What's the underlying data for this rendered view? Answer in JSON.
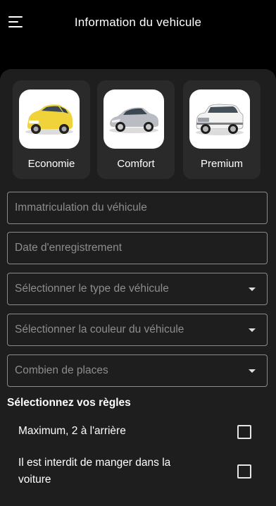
{
  "header": {
    "title": "Information du vehicule",
    "menu_icon": "hamburger-menu-icon"
  },
  "categories": [
    {
      "label": "Economie",
      "image": "yellow-hatchback-car"
    },
    {
      "label": "Comfort",
      "image": "silver-sedan-car"
    },
    {
      "label": "Premium",
      "image": "white-suv-car"
    }
  ],
  "form": {
    "registration_placeholder": "Immatriculation du véhicule",
    "date_placeholder": "Date d'enregistrement",
    "type_placeholder": "Sélectionner le type de véhicule",
    "color_placeholder": "Sélectionner la couleur du véhicule",
    "seats_placeholder": "Combien de places"
  },
  "rules": {
    "title": "Sélectionnez vos règles",
    "items": [
      {
        "label": "Maximum, 2 à l'arrière",
        "checked": false
      },
      {
        "label_line1": "Il est interdit de manger dans la",
        "label_line2": "voiture",
        "checked": false
      }
    ]
  },
  "colors": {
    "background": "#000000",
    "panel": "#1e1e1e",
    "card": "#2a2a2a",
    "placeholder": "#8d8d8d",
    "border": "#8a8a8a"
  }
}
